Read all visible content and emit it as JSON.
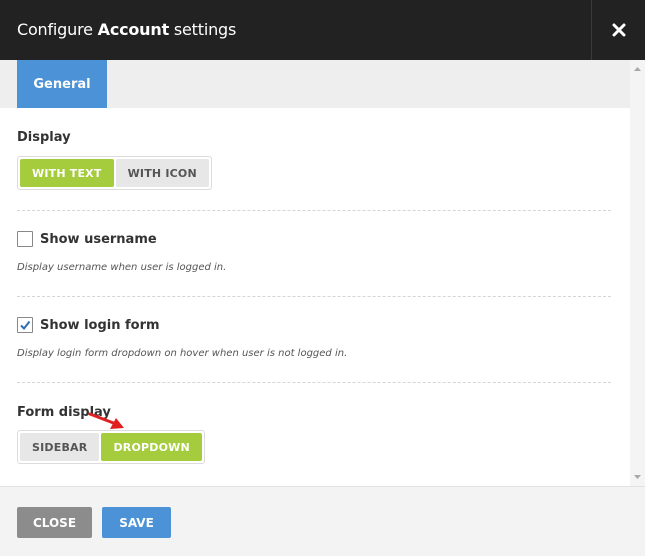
{
  "header": {
    "title_prefix": "Configure ",
    "title_bold": "Account",
    "title_suffix": " settings",
    "close_icon": "close-icon"
  },
  "tabs": [
    {
      "label": "General",
      "active": true
    }
  ],
  "display": {
    "label": "Display",
    "options": [
      {
        "label": "WITH TEXT",
        "active": true
      },
      {
        "label": "WITH ICON",
        "active": false
      }
    ]
  },
  "show_username": {
    "label": "Show username",
    "checked": false,
    "help": "Display username when user is logged in."
  },
  "show_login_form": {
    "label": "Show login form",
    "checked": true,
    "help": "Display login form dropdown on hover when user is not logged in."
  },
  "form_display": {
    "label": "Form display",
    "options": [
      {
        "label": "SIDEBAR",
        "active": false
      },
      {
        "label": "DROPDOWN",
        "active": true
      }
    ]
  },
  "footer": {
    "close_label": "CLOSE",
    "save_label": "SAVE"
  },
  "colors": {
    "header_bg": "#222222",
    "accent_blue": "#4b92d6",
    "active_green": "#a4cc3c",
    "annotation_arrow": "#e02020"
  }
}
